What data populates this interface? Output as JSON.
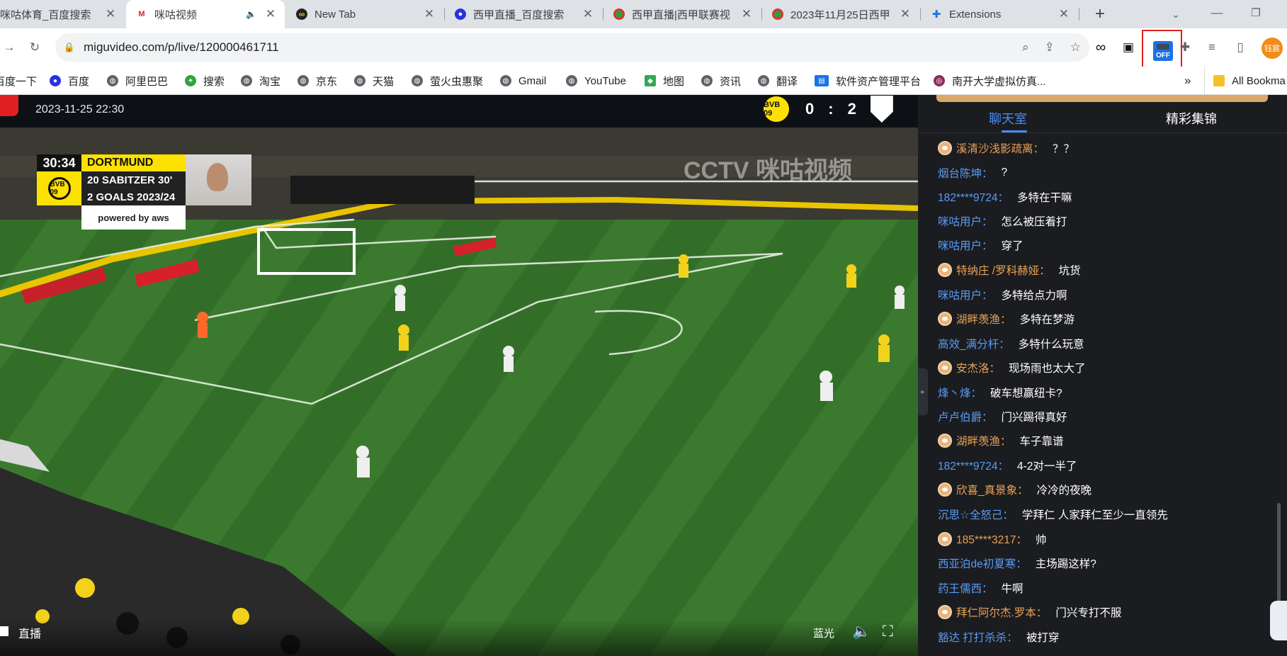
{
  "tabs": [
    {
      "title": "咪咕体育_百度搜索",
      "icon": "baidu-icon",
      "active": false
    },
    {
      "title": "咪咕视频",
      "icon": "migu-icon",
      "active": true,
      "audio": true
    },
    {
      "title": "New Tab",
      "icon": "infinity-icon",
      "active": false
    },
    {
      "title": "西甲直播_百度搜索",
      "icon": "baidu-paw-icon",
      "active": false
    },
    {
      "title": "西甲直播|西甲联赛视",
      "icon": "ball-icon",
      "active": false
    },
    {
      "title": "2023年11月25日西甲",
      "icon": "ball-icon",
      "active": false
    },
    {
      "title": "Extensions",
      "icon": "puzzle-icon",
      "active": false
    }
  ],
  "address": {
    "url": "miguvideo.com/p/live/120000461711"
  },
  "extension_badge": "OFF",
  "profile_label": "钰宸",
  "bookmarks": [
    {
      "label": "百度一下",
      "icon": "globe-icon"
    },
    {
      "label": "百度",
      "icon": "baidu-paw-icon"
    },
    {
      "label": "阿里巴巴",
      "icon": "globe-icon"
    },
    {
      "label": "搜索",
      "icon": "search-engine-icon"
    },
    {
      "label": "淘宝",
      "icon": "globe-icon"
    },
    {
      "label": "京东",
      "icon": "globe-icon"
    },
    {
      "label": "天猫",
      "icon": "globe-icon"
    },
    {
      "label": "萤火虫惠聚",
      "icon": "globe-icon"
    },
    {
      "label": "Gmail",
      "icon": "globe-icon"
    },
    {
      "label": "YouTube",
      "icon": "globe-icon"
    },
    {
      "label": "地图",
      "icon": "maps-icon"
    },
    {
      "label": "资讯",
      "icon": "globe-icon"
    },
    {
      "label": "翻译",
      "icon": "globe-icon"
    },
    {
      "label": "软件资产管理平台",
      "icon": "software-icon"
    },
    {
      "label": "南开大学虚拟仿真...",
      "icon": "nankai-icon"
    }
  ],
  "bookmarks_overflow": "»",
  "all_bookmarks": "All Bookma",
  "video": {
    "date": "2023-11-25 22:30",
    "score_home": "0",
    "score_sep": ":",
    "score_away": "2",
    "home_crest": "BVB 09",
    "overlay": {
      "time": "30:34",
      "team": "DORTMUND",
      "player": "20 SABITZER  30'",
      "goals": "2 GOALS 2023/24",
      "sponsor": "powered by aws"
    },
    "watermark": "CCTV 咪咕视频",
    "live_label": "直播",
    "quality_label": "蓝光"
  },
  "panel": {
    "tab_chat": "聊天室",
    "tab_highlights": "精彩集锦"
  },
  "chat": [
    {
      "user": "溪清沙浅影疏离：",
      "text": "？？",
      "vip": true
    },
    {
      "user": "烟台陈坤：",
      "text": "?",
      "vip": false
    },
    {
      "user": "182****9724：",
      "text": "多特在干嘛",
      "vip": false
    },
    {
      "user": "咪咕用户：",
      "text": "怎么被压着打",
      "vip": false
    },
    {
      "user": "咪咕用户：",
      "text": "穿了",
      "vip": false
    },
    {
      "user": "特纳庄 /罗科赫娅：",
      "text": "坑货",
      "vip": true
    },
    {
      "user": "咪咕用户：",
      "text": "多特给点力啊",
      "vip": false
    },
    {
      "user": "湖畔羡渔：",
      "text": "多特在梦游",
      "vip": true
    },
    {
      "user": "高效_满分杆：",
      "text": "多特什么玩意",
      "vip": false
    },
    {
      "user": "安杰洛：",
      "text": "现场雨也太大了",
      "vip": true
    },
    {
      "user": "烽丶烽：",
      "text": "破车想赢纽卡?",
      "vip": false
    },
    {
      "user": "卢卢伯爵：",
      "text": "门兴踢得真好",
      "vip": false
    },
    {
      "user": "湖畔羡渔：",
      "text": "车子靠谱",
      "vip": true
    },
    {
      "user": "182****9724：",
      "text": "4-2对一半了",
      "vip": false
    },
    {
      "user": "欣喜_真景象：",
      "text": "冷冷的夜晚",
      "vip": true
    },
    {
      "user": "沉思☆全怒己：",
      "text": "学拜仁 人家拜仁至少一直领先",
      "vip": false
    },
    {
      "user": "185****3217：",
      "text": "帅",
      "vip": true
    },
    {
      "user": "西亚泊de初夏寒：",
      "text": "主场踢这样?",
      "vip": false
    },
    {
      "user": "药王儒西：",
      "text": "牛啊",
      "vip": false
    },
    {
      "user": "拜仁阿尔杰.罗本：",
      "text": "门兴专打不服",
      "vip": true
    },
    {
      "user": "豁达 打打杀杀：",
      "text": "被打穿",
      "vip": false
    }
  ]
}
